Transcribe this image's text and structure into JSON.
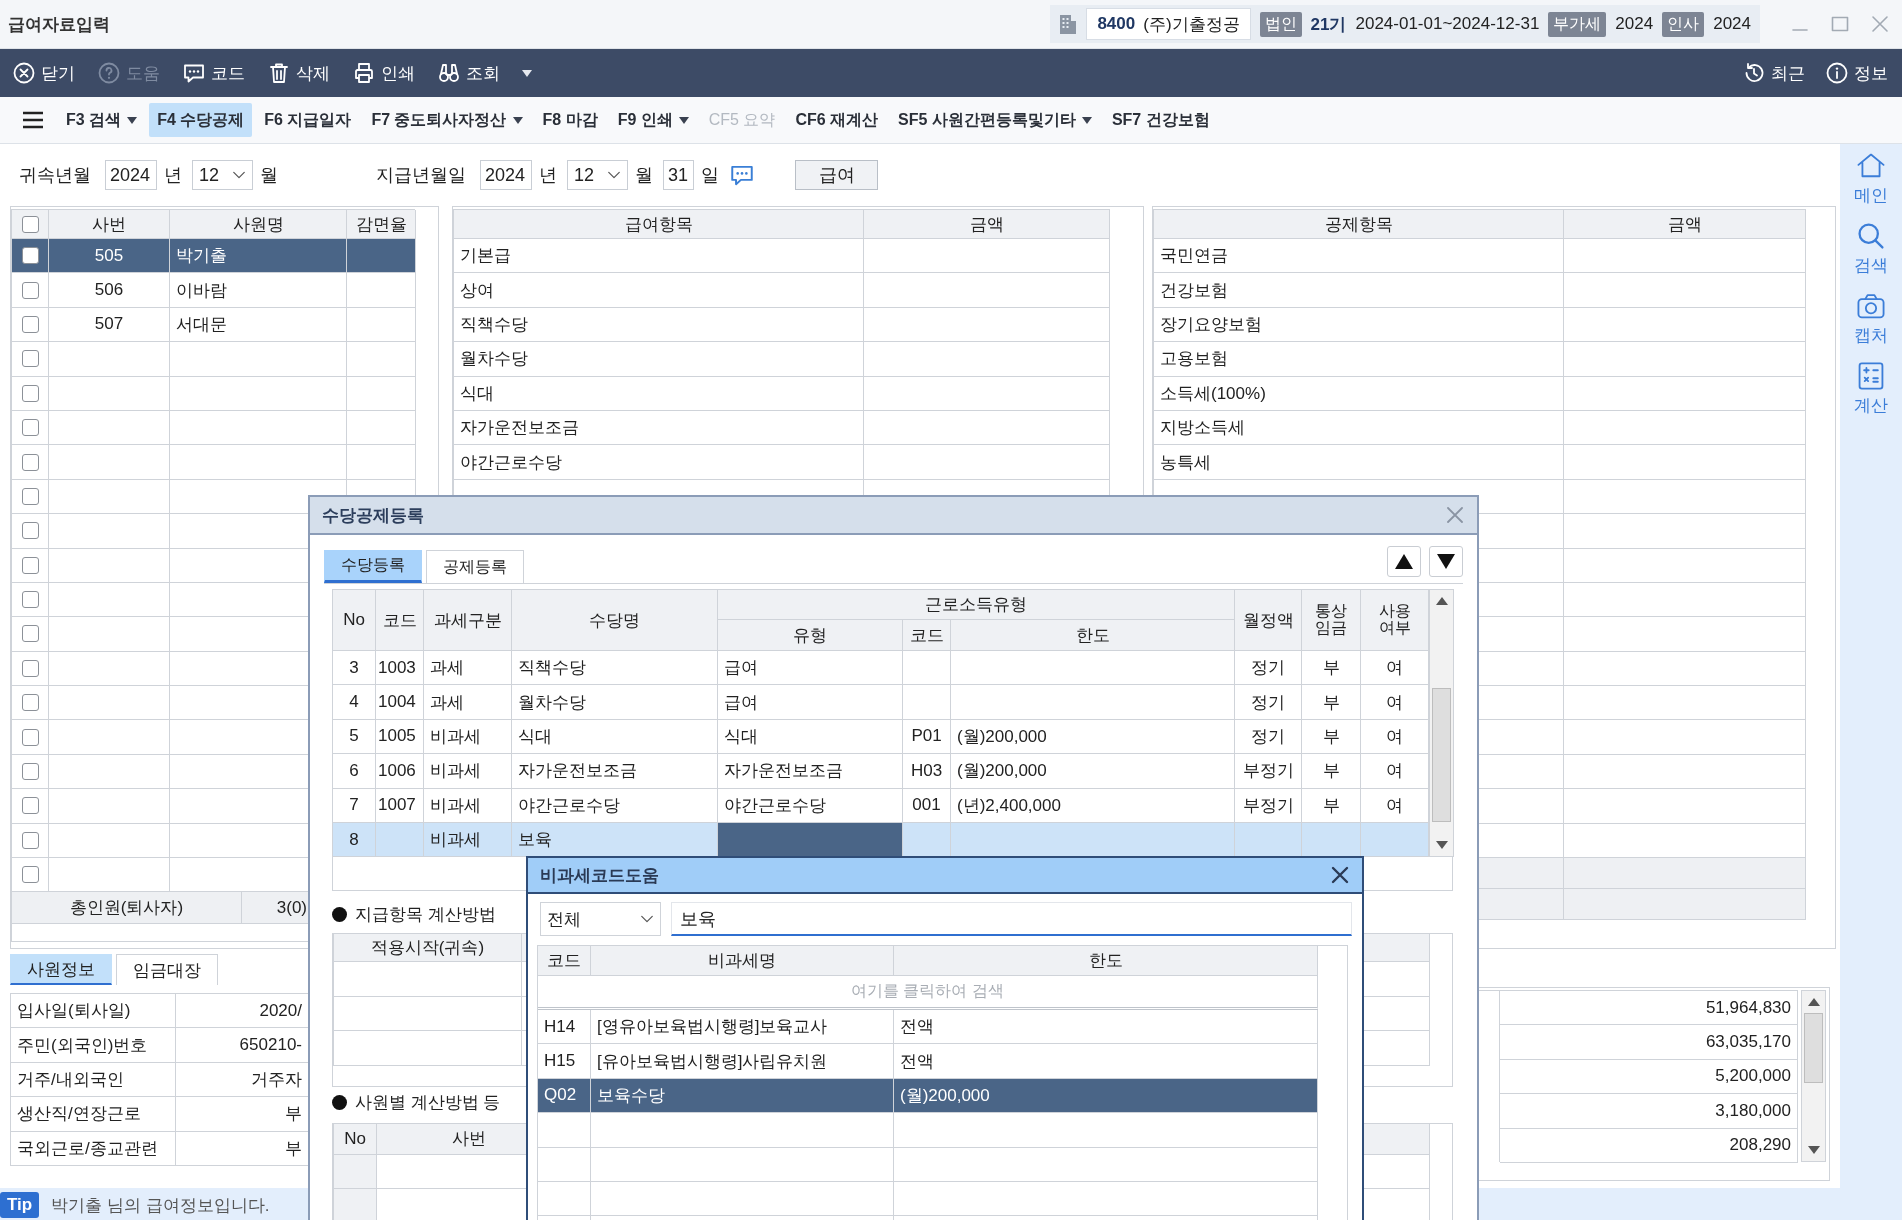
{
  "window": {
    "title": "급여자료입력",
    "company_code": "8400",
    "company_name": "(주)기출정공",
    "corp_badge": "법인",
    "term": "21기",
    "period": "2024-01-01~2024-12-31",
    "vat_badge": "부가세",
    "vat_year": "2024",
    "hr_badge": "인사",
    "hr_year": "2024"
  },
  "toolbar": {
    "buttons": [
      {
        "kind": "close",
        "label": "닫기",
        "disabled": false
      },
      {
        "kind": "help",
        "label": "도움",
        "disabled": true
      },
      {
        "kind": "code",
        "label": "코드",
        "disabled": false
      },
      {
        "kind": "delete",
        "label": "삭제",
        "disabled": false
      },
      {
        "kind": "print",
        "label": "인쇄",
        "disabled": false
      },
      {
        "kind": "inquiry",
        "label": "조회",
        "disabled": false
      }
    ],
    "more_menu": true,
    "right_buttons": [
      {
        "kind": "recent",
        "label": "최근"
      },
      {
        "kind": "info",
        "label": "정보"
      }
    ]
  },
  "function_keys": [
    {
      "label": "F3 검색",
      "dropdown": true,
      "selected": false,
      "disabled": false
    },
    {
      "label": "F4 수당공제",
      "dropdown": false,
      "selected": true,
      "disabled": false
    },
    {
      "label": "F6 지급일자",
      "dropdown": false,
      "selected": false,
      "disabled": false
    },
    {
      "label": "F7 중도퇴사자정산",
      "dropdown": true,
      "selected": false,
      "disabled": false
    },
    {
      "label": "F8 마감",
      "dropdown": false,
      "selected": false,
      "disabled": false
    },
    {
      "label": "F9 인쇄",
      "dropdown": true,
      "selected": false,
      "disabled": false
    },
    {
      "label": "CF5 요약",
      "dropdown": false,
      "selected": false,
      "disabled": true
    },
    {
      "label": "CF6 재계산",
      "dropdown": false,
      "selected": false,
      "disabled": false
    },
    {
      "label": "SF5 사원간편등록및기타",
      "dropdown": true,
      "selected": false,
      "disabled": false
    },
    {
      "label": "SF7 건강보험",
      "dropdown": false,
      "selected": false,
      "disabled": false
    }
  ],
  "period": {
    "belong_label": "귀속년월",
    "belong_year": "2024",
    "belong_year_unit": "년",
    "belong_month": "12",
    "belong_month_unit": "월",
    "pay_label": "지급년월일",
    "pay_year": "2024",
    "pay_year_unit": "년",
    "pay_month": "12",
    "pay_month_unit": "월",
    "pay_day": "31",
    "pay_day_unit": "일",
    "pay_type": "급여"
  },
  "employees": {
    "all_checked": false,
    "columns": [
      "사번",
      "사원명",
      "감면율"
    ],
    "rows": [
      {
        "number": "505",
        "name": "박기출",
        "checked": false,
        "selected": true
      },
      {
        "number": "506",
        "name": "이바람",
        "checked": false,
        "selected": false
      },
      {
        "number": "507",
        "name": "서대문",
        "checked": false,
        "selected": false
      },
      {
        "checked": false,
        "selected": false
      },
      {
        "checked": false,
        "selected": false
      },
      {
        "checked": false,
        "selected": false
      },
      {
        "checked": false,
        "selected": false
      },
      {
        "checked": false,
        "selected": false
      },
      {
        "checked": false,
        "selected": false
      },
      {
        "checked": false,
        "selected": false
      },
      {
        "checked": false,
        "selected": false
      },
      {
        "checked": false,
        "selected": false
      },
      {
        "checked": false,
        "selected": false
      },
      {
        "checked": false,
        "selected": false
      },
      {
        "checked": false,
        "selected": false
      },
      {
        "checked": false,
        "selected": false
      },
      {
        "checked": false,
        "selected": false
      },
      {
        "checked": false,
        "selected": false
      },
      {
        "checked": false,
        "selected": false
      }
    ],
    "total_label": "총인원(퇴사자)",
    "total_value": "3(0)"
  },
  "pay_items": {
    "columns": [
      "급여항목",
      "금액"
    ],
    "rows": [
      "기본급",
      "상여",
      "직책수당",
      "월차수당",
      "식대",
      "자가운전보조금",
      "야간근로수당"
    ]
  },
  "deduction_items": {
    "columns": [
      "공제항목",
      "금액"
    ],
    "rows": [
      "국민연금",
      "건강보험",
      "장기요양보험",
      "고용보험",
      "소득세(100%)",
      "지방소득세",
      "농특세"
    ]
  },
  "employee_info": {
    "tabs": [
      {
        "label": "사원정보",
        "selected": true
      },
      {
        "label": "임금대장",
        "selected": false
      }
    ],
    "rows": [
      {
        "label": "입사일(퇴사일)",
        "value": "2020/"
      },
      {
        "label": "주민(외국인)번호",
        "value": "650210-"
      },
      {
        "label": "거주/내외국인",
        "value": "거주자"
      },
      {
        "label": "생산직/연장근로",
        "value": "부"
      },
      {
        "label": "국외근로/종교관련",
        "value": "부"
      }
    ]
  },
  "summary": {
    "values": [
      "51,964,830",
      "63,035,170",
      "5,200,000",
      "3,180,000",
      "208,290"
    ]
  },
  "status_bar": {
    "badge": "Tip",
    "message": "박기출 님의 급여정보입니다."
  },
  "side_menu": [
    {
      "kind": "home",
      "label": "메인"
    },
    {
      "kind": "search",
      "label": "검색"
    },
    {
      "kind": "capture",
      "label": "캡처"
    },
    {
      "kind": "calculator",
      "label": "계산"
    }
  ],
  "allowance_dialog": {
    "title": "수당공제등록",
    "tabs": [
      {
        "label": "수당등록",
        "selected": true
      },
      {
        "label": "공제등록",
        "selected": false
      }
    ],
    "columns": {
      "no": "No",
      "code": "코드",
      "tax_type": "과세구분",
      "name": "수당명",
      "group": "근로소득유형",
      "type": "유형",
      "type_code": "코드",
      "limit": "한도",
      "monthly": "월정액",
      "ordinary_wage": "통상임금",
      "in_use": "사용여부"
    },
    "rows": [
      {
        "no": "3",
        "code": "1003",
        "tax_type": "과세",
        "name": "직책수당",
        "type": "급여",
        "monthly": "정기",
        "ordinary_wage": "부",
        "in_use": "여",
        "selected": false,
        "type_focused": false
      },
      {
        "no": "4",
        "code": "1004",
        "tax_type": "과세",
        "name": "월차수당",
        "type": "급여",
        "monthly": "정기",
        "ordinary_wage": "부",
        "in_use": "여",
        "selected": false,
        "type_focused": false
      },
      {
        "no": "5",
        "code": "1005",
        "tax_type": "비과세",
        "name": "식대",
        "type": "식대",
        "type_code": "P01",
        "limit": "(월)200,000",
        "monthly": "정기",
        "ordinary_wage": "부",
        "in_use": "여",
        "selected": false,
        "type_focused": false
      },
      {
        "no": "6",
        "code": "1006",
        "tax_type": "비과세",
        "name": "자가운전보조금",
        "type": "자가운전보조금",
        "type_code": "H03",
        "limit": "(월)200,000",
        "monthly": "부정기",
        "ordinary_wage": "부",
        "in_use": "여",
        "selected": false,
        "type_focused": false
      },
      {
        "no": "7",
        "code": "1007",
        "tax_type": "비과세",
        "name": "야간근로수당",
        "type": "야간근로수당",
        "type_code": "001",
        "limit": "(년)2,400,000",
        "monthly": "부정기",
        "ordinary_wage": "부",
        "in_use": "여",
        "selected": false,
        "type_focused": false
      },
      {
        "no": "8",
        "tax_type": "비과세",
        "name": "보육",
        "selected": true,
        "type_focused": true
      }
    ],
    "calc_section": {
      "title": "지급항목 계산방법",
      "columns": [
        "적용시작(귀속)"
      ]
    },
    "employee_section": {
      "title": "사원별 계산방법 등",
      "columns": [
        "No",
        "사번"
      ]
    }
  },
  "tax_free_dialog": {
    "title": "비과세코드도움",
    "filter": "전체",
    "query": "보육",
    "columns": [
      "코드",
      "비과세명",
      "한도"
    ],
    "search_hint": "여기를 클릭하여 검색",
    "rows": [
      {
        "code": "H14",
        "name": "[영유아보육법시행령]보육교사",
        "limit": "전액",
        "selected": false
      },
      {
        "code": "H15",
        "name": "[유아보육법시행령]사립유치원",
        "limit": "전액",
        "selected": false
      },
      {
        "code": "Q02",
        "name": "보육수당",
        "limit": "(월)200,000",
        "selected": true
      }
    ]
  }
}
